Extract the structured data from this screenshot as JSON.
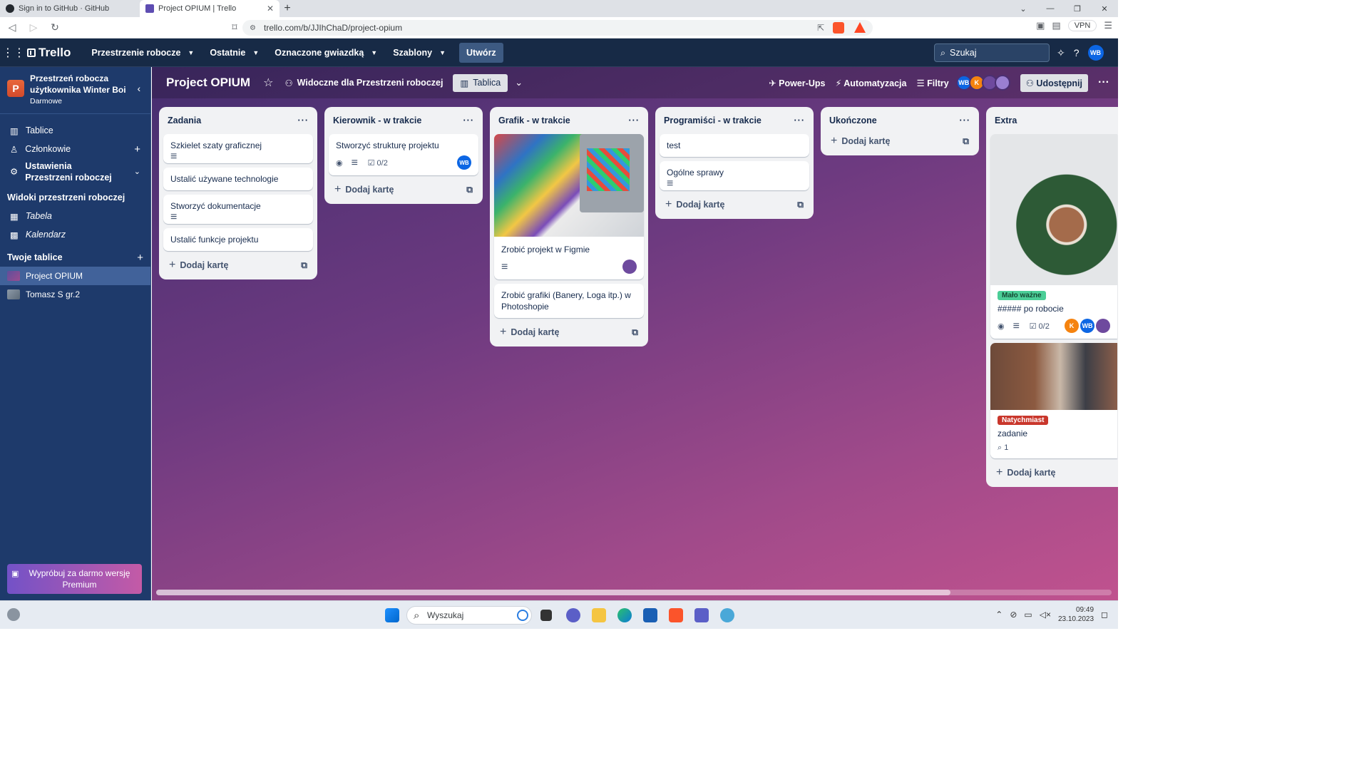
{
  "browser": {
    "tabs": [
      {
        "title": "Sign in to GitHub · GitHub"
      },
      {
        "title": "Project OPIUM | Trello"
      }
    ],
    "url": "trello.com/b/JJIhChaD/project-opium",
    "vpn_label": "VPN"
  },
  "header": {
    "logo": "Trello",
    "menus": [
      "Przestrzenie robocze",
      "Ostatnie",
      "Oznaczone gwiazdką",
      "Szablony"
    ],
    "create": "Utwórz",
    "search_placeholder": "Szukaj",
    "user_initials": "WB"
  },
  "sidebar": {
    "workspace_initial": "P",
    "workspace_name": "Przestrzeń robocza użytkownika Winter Boi",
    "workspace_plan": "Darmowe",
    "items": [
      {
        "label": "Tablice"
      },
      {
        "label": "Członkowie"
      },
      {
        "label": "Ustawienia Przestrzeni roboczej"
      }
    ],
    "views_heading": "Widoki przestrzeni roboczej",
    "views": [
      {
        "label": "Tabela"
      },
      {
        "label": "Kalendarz"
      }
    ],
    "boards_heading": "Twoje tablice",
    "boards": [
      {
        "label": "Project OPIUM"
      },
      {
        "label": "Tomasz S gr.2"
      }
    ],
    "premium": "Wypróbuj za darmo wersję Premium"
  },
  "board": {
    "title": "Project OPIUM",
    "visibility": "Widoczne dla Przestrzeni roboczej",
    "view": "Tablica",
    "powerups": "Power-Ups",
    "automation": "Automatyzacja",
    "filters": "Filtry",
    "share": "Udostępnij",
    "add_card": "Dodaj kartę"
  },
  "lists": [
    {
      "title": "Zadania",
      "cards": [
        {
          "title": "Szkielet szaty graficznej"
        },
        {
          "title": "Ustalić używane technologie"
        },
        {
          "title": "Stworzyć dokumentacje"
        },
        {
          "title": "Ustalić funkcje projektu"
        }
      ]
    },
    {
      "title": "Kierownik - w trakcie",
      "cards": [
        {
          "title": "Stworzyć strukturę projektu",
          "checklist": "0/2",
          "member": "WB"
        }
      ]
    },
    {
      "title": "Grafik - w trakcie",
      "cards": [
        {
          "title": "Zrobić projekt w Figmie"
        },
        {
          "title": "Zrobić grafiki (Banery, Loga itp.) w Photoshopie"
        }
      ]
    },
    {
      "title": "Programiści - w trakcie",
      "cards": [
        {
          "title": "test"
        },
        {
          "title": "Ogólne sprawy"
        }
      ]
    },
    {
      "title": "Ukończone",
      "cards": []
    },
    {
      "title": "Extra",
      "cards": [
        {
          "label": "Mało ważne",
          "title": "##### po robocie",
          "checklist": "0/2",
          "members": [
            "K",
            "WB"
          ]
        },
        {
          "label": "Natychmiast",
          "title": "zadanie",
          "attachments": "1"
        }
      ]
    }
  ],
  "colors": {
    "label_low": "#4bce97",
    "label_urgent": "#c9372c",
    "accent": "#0c66e4"
  },
  "taskbar": {
    "search": "Wyszukaj",
    "time": "09:49",
    "date": "23.10.2023"
  }
}
